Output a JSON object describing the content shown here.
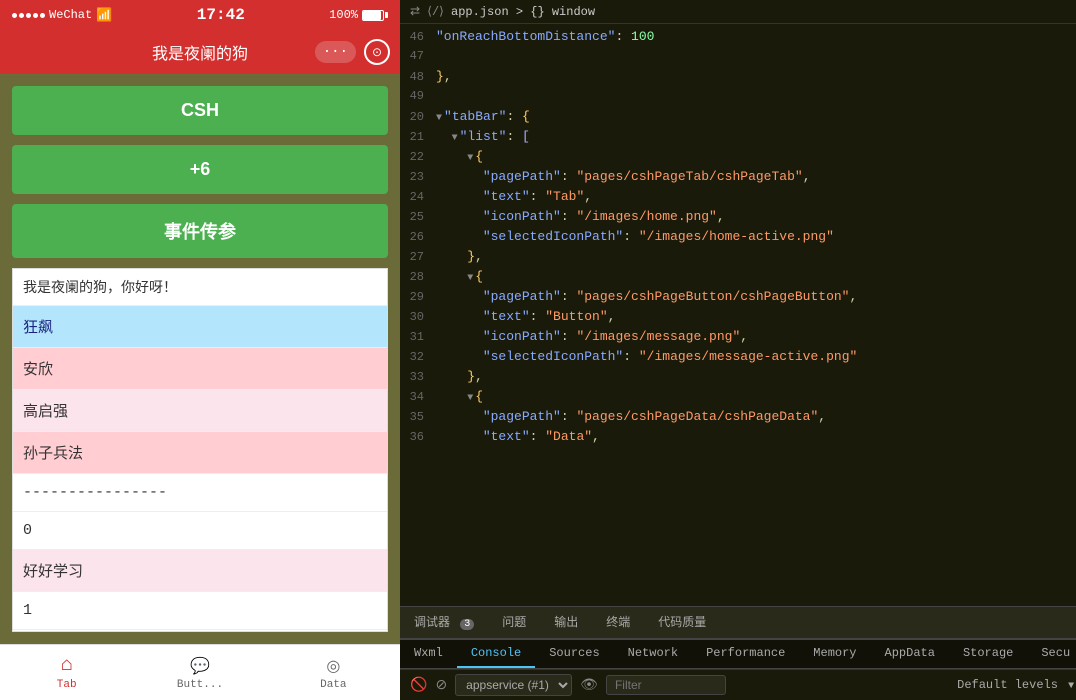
{
  "wechat": {
    "status_bar": {
      "dots": 5,
      "app_name": "WeChat",
      "wifi_icon": "WiFi",
      "time": "17:42",
      "battery_pct": "100%"
    },
    "title": "我是夜阑的狗",
    "buttons": {
      "more": "···",
      "record": "⊙"
    },
    "app": {
      "btn1": "CSH",
      "btn2": "+6",
      "btn3": "事件传参",
      "input_placeholder": "我是夜阑的狗，你好呀！",
      "list_items": [
        {
          "text": "狂飙",
          "style": "blue-highlight"
        },
        {
          "text": "安欣",
          "style": "pink"
        },
        {
          "text": "高启强",
          "style": "pink-light"
        },
        {
          "text": "孙子兵法",
          "style": "pink"
        },
        {
          "text": "----------------",
          "style": "white"
        },
        {
          "text": "0",
          "style": "white"
        },
        {
          "text": "好好学习",
          "style": "pink-light"
        },
        {
          "text": "1",
          "style": "white"
        }
      ]
    },
    "tabbar": {
      "items": [
        {
          "label": "Tab",
          "active": true
        },
        {
          "label": "Butt...",
          "active": false
        },
        {
          "label": "Data",
          "active": false
        }
      ]
    }
  },
  "editor": {
    "breadcrumb": "app.json > {} window",
    "lines": [
      {
        "num": "46",
        "collapse": false,
        "content": "\"onReachBottomDistance\": 100"
      },
      {
        "num": "47",
        "collapse": false,
        "content": ""
      },
      {
        "num": "48",
        "collapse": false,
        "content": "},"
      },
      {
        "num": "49",
        "collapse": false,
        "content": ""
      },
      {
        "num": "20",
        "collapse": true,
        "content": "\"tabBar\": {"
      },
      {
        "num": "21",
        "collapse": true,
        "content": "  \"list\": ["
      },
      {
        "num": "22",
        "collapse": true,
        "content": "    {"
      },
      {
        "num": "23",
        "collapse": false,
        "content": "      \"pagePath\": \"pages/cshPageTab/cshPageTab\","
      },
      {
        "num": "24",
        "collapse": false,
        "content": "      \"text\": \"Tab\","
      },
      {
        "num": "25",
        "collapse": false,
        "content": "      \"iconPath\": \"/images/home.png\","
      },
      {
        "num": "26",
        "collapse": false,
        "content": "      \"selectedIconPath\": \"/images/home-active.png\""
      },
      {
        "num": "27",
        "collapse": false,
        "content": "    },"
      },
      {
        "num": "28",
        "collapse": true,
        "content": "    {"
      },
      {
        "num": "29",
        "collapse": false,
        "content": "      \"pagePath\": \"pages/cshPageButton/cshPageButton\","
      },
      {
        "num": "30",
        "collapse": false,
        "content": "      \"text\": \"Button\","
      },
      {
        "num": "31",
        "collapse": false,
        "content": "      \"iconPath\": \"/images/message.png\","
      },
      {
        "num": "32",
        "collapse": false,
        "content": "      \"selectedIconPath\": \"/images/message-active.png\""
      },
      {
        "num": "33",
        "collapse": false,
        "content": "    },"
      },
      {
        "num": "34",
        "collapse": true,
        "content": "    {"
      },
      {
        "num": "35",
        "collapse": false,
        "content": "      \"pagePath\": \"pages/cshPageData/cshPageData\","
      },
      {
        "num": "36",
        "collapse": false,
        "content": "      \"text\": \"Data\","
      }
    ],
    "bottom_tabs": [
      {
        "label": "调试器",
        "badge": "3",
        "active": false
      },
      {
        "label": "问题",
        "badge": null,
        "active": false
      },
      {
        "label": "输出",
        "badge": null,
        "active": false
      },
      {
        "label": "终端",
        "badge": null,
        "active": false
      },
      {
        "label": "代码质量",
        "badge": null,
        "active": false
      }
    ],
    "devtools_tabs": [
      {
        "label": "Wxml",
        "active": false
      },
      {
        "label": "Console",
        "active": true
      },
      {
        "label": "Sources",
        "active": false
      },
      {
        "label": "Network",
        "active": false
      },
      {
        "label": "Performance",
        "active": false
      },
      {
        "label": "Memory",
        "active": false
      },
      {
        "label": "AppData",
        "active": false
      },
      {
        "label": "Storage",
        "active": false
      },
      {
        "label": "Secu",
        "active": false
      }
    ],
    "bottom_bar": {
      "appservice": "appservice (#1)",
      "filter_placeholder": "Filter",
      "default_levels": "Default levels"
    }
  }
}
